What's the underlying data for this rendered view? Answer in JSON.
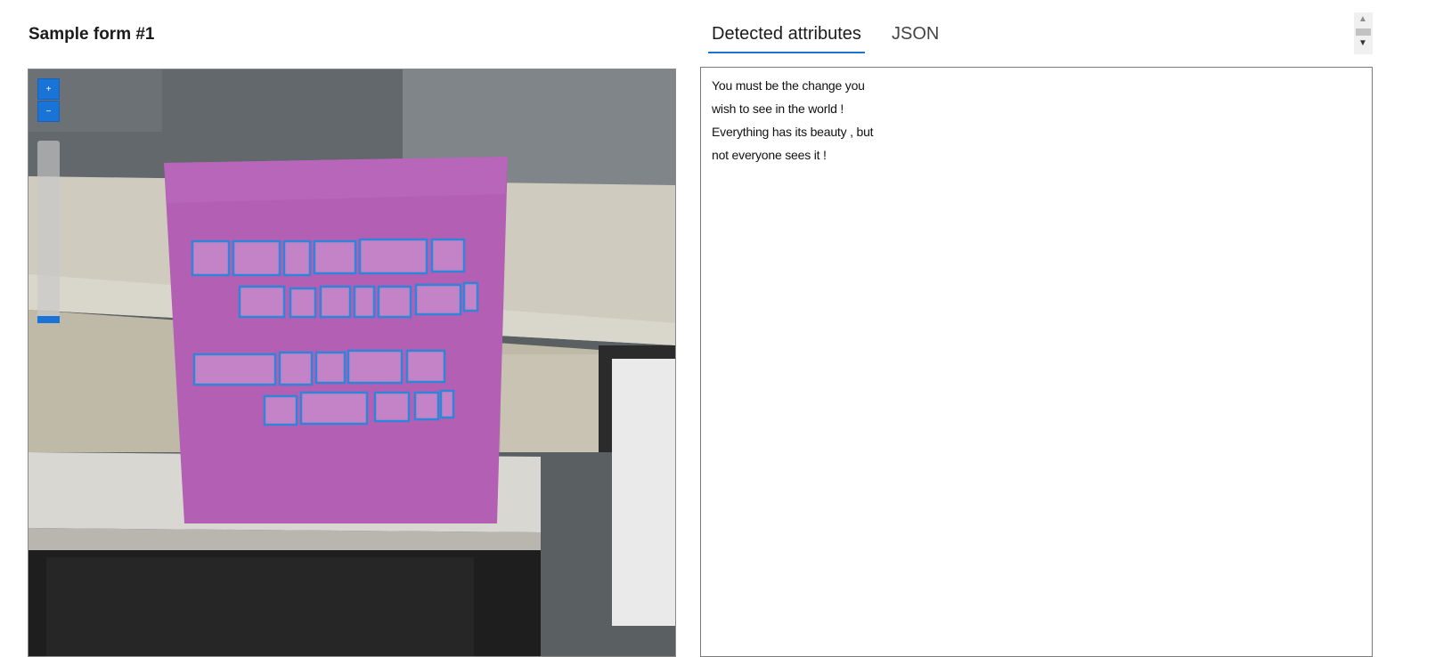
{
  "form": {
    "title": "Sample form #1"
  },
  "viewer": {
    "zoom_in_symbol": "+",
    "zoom_out_symbol": "−",
    "accent_color": "#1a73d6",
    "note_color": "#b25fb4",
    "box_color": "#2f86d8"
  },
  "tabs": [
    {
      "label": "Detected attributes",
      "selected": true
    },
    {
      "label": "JSON",
      "selected": false
    }
  ],
  "detected_text": [
    "You must be the change you",
    "wish to see in the world !",
    "Everything has its beauty , but",
    "not everyone sees it !"
  ],
  "scrollbar": {
    "up_symbol": "▲",
    "down_symbol": "▼"
  }
}
